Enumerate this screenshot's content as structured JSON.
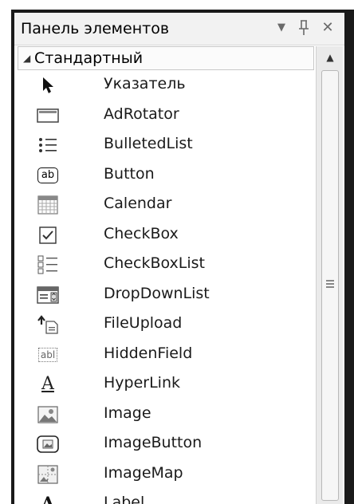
{
  "panel": {
    "title": "Панель элементов",
    "dropdown_glyph": "▼",
    "pin_glyph": "ᛘ",
    "close_glyph": "✕"
  },
  "group": {
    "arrow_glyph": "◢",
    "label": "Стандартный"
  },
  "scrollbar": {
    "up_glyph": "▲"
  },
  "items": [
    {
      "label": "Указатель",
      "icon": "pointer-icon"
    },
    {
      "label": "AdRotator",
      "icon": "adrotator-icon"
    },
    {
      "label": "BulletedList",
      "icon": "bulleted-list-icon"
    },
    {
      "label": "Button",
      "icon": "button-icon"
    },
    {
      "label": "Calendar",
      "icon": "calendar-icon"
    },
    {
      "label": "CheckBox",
      "icon": "checkbox-icon"
    },
    {
      "label": "CheckBoxList",
      "icon": "checkbox-list-icon"
    },
    {
      "label": "DropDownList",
      "icon": "dropdown-list-icon"
    },
    {
      "label": "FileUpload",
      "icon": "file-upload-icon"
    },
    {
      "label": "HiddenField",
      "icon": "hidden-field-icon"
    },
    {
      "label": "HyperLink",
      "icon": "hyperlink-icon"
    },
    {
      "label": "Image",
      "icon": "image-icon"
    },
    {
      "label": "ImageButton",
      "icon": "image-button-icon"
    },
    {
      "label": "ImageMap",
      "icon": "image-map-icon"
    },
    {
      "label": "Label",
      "icon": "label-icon"
    }
  ],
  "icon_text": {
    "button": "ab",
    "hidden_field": "abl",
    "hyperlink": "A",
    "label": "A"
  }
}
